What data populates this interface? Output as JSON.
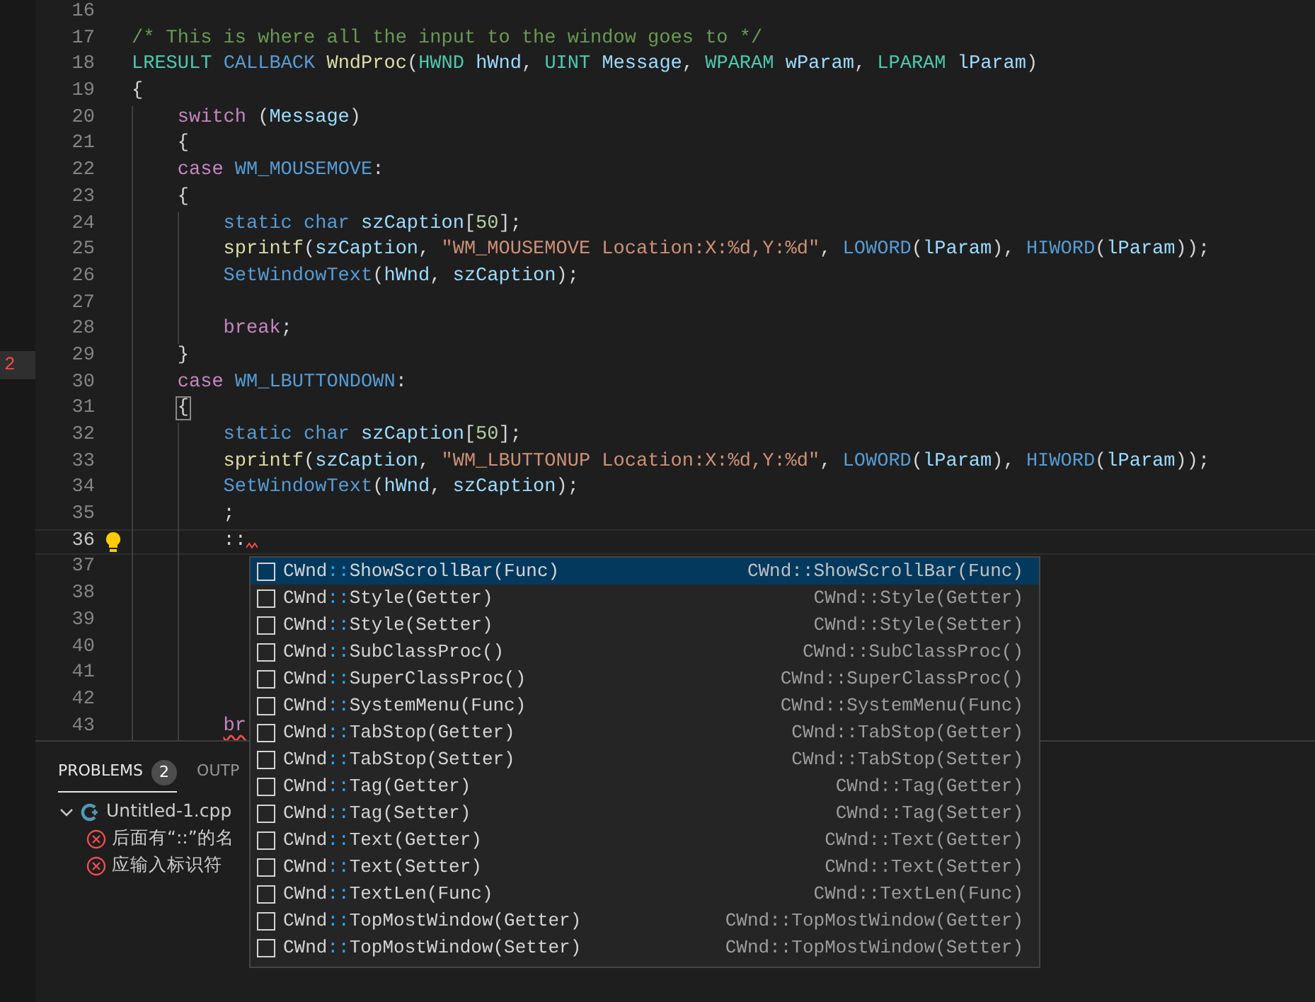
{
  "side_strip": {
    "marker": "2"
  },
  "editor": {
    "lines": [
      {
        "number": "16"
      },
      {
        "number": "17",
        "tokens": [
          {
            "kind": "comment",
            "text": "/* This is where all the input to the window goes to */"
          }
        ]
      },
      {
        "number": "18",
        "tokens": [
          {
            "kind": "type",
            "text": "LRESULT "
          },
          {
            "kind": "macro",
            "text": "CALLBACK "
          },
          {
            "kind": "func",
            "text": "WndProc"
          },
          {
            "kind": "plain",
            "text": "("
          },
          {
            "kind": "type",
            "text": "HWND "
          },
          {
            "kind": "var",
            "text": "hWnd"
          },
          {
            "kind": "plain",
            "text": ", "
          },
          {
            "kind": "type",
            "text": "UINT "
          },
          {
            "kind": "var",
            "text": "Message"
          },
          {
            "kind": "plain",
            "text": ", "
          },
          {
            "kind": "type",
            "text": "WPARAM "
          },
          {
            "kind": "var",
            "text": "wParam"
          },
          {
            "kind": "plain",
            "text": ", "
          },
          {
            "kind": "type",
            "text": "LPARAM "
          },
          {
            "kind": "var",
            "text": "lParam"
          },
          {
            "kind": "plain",
            "text": ")"
          }
        ]
      },
      {
        "number": "19",
        "tokens": [
          {
            "kind": "plain",
            "text": "{"
          }
        ]
      },
      {
        "number": "20",
        "tokens": [
          {
            "kind": "control",
            "text": "    switch"
          },
          {
            "kind": "plain",
            "text": " ("
          },
          {
            "kind": "var",
            "text": "Message"
          },
          {
            "kind": "plain",
            "text": ")"
          }
        ]
      },
      {
        "number": "21",
        "tokens": [
          {
            "kind": "plain",
            "text": "    {"
          }
        ]
      },
      {
        "number": "22",
        "tokens": [
          {
            "kind": "control",
            "text": "    case "
          },
          {
            "kind": "macro",
            "text": "WM_MOUSEMOVE"
          },
          {
            "kind": "plain",
            "text": ":"
          }
        ]
      },
      {
        "number": "23",
        "tokens": [
          {
            "kind": "plain",
            "text": "    {"
          }
        ]
      },
      {
        "number": "24",
        "tokens": [
          {
            "kind": "macro",
            "text": "        static char "
          },
          {
            "kind": "var",
            "text": "szCaption"
          },
          {
            "kind": "plain",
            "text": "["
          },
          {
            "kind": "number",
            "text": "50"
          },
          {
            "kind": "plain",
            "text": "];"
          }
        ]
      },
      {
        "number": "25",
        "tokens": [
          {
            "kind": "func",
            "text": "        sprintf"
          },
          {
            "kind": "plain",
            "text": "("
          },
          {
            "kind": "var",
            "text": "szCaption"
          },
          {
            "kind": "plain",
            "text": ", "
          },
          {
            "kind": "string",
            "text": "\"WM_MOUSEMOVE Location:X:%d,Y:%d\""
          },
          {
            "kind": "plain",
            "text": ", "
          },
          {
            "kind": "macro",
            "text": "LOWORD"
          },
          {
            "kind": "plain",
            "text": "("
          },
          {
            "kind": "var",
            "text": "lParam"
          },
          {
            "kind": "plain",
            "text": "), "
          },
          {
            "kind": "macro",
            "text": "HIWORD"
          },
          {
            "kind": "plain",
            "text": "("
          },
          {
            "kind": "var",
            "text": "lParam"
          },
          {
            "kind": "plain",
            "text": "));"
          }
        ]
      },
      {
        "number": "26",
        "tokens": [
          {
            "kind": "macro",
            "text": "        SetWindowText"
          },
          {
            "kind": "plain",
            "text": "("
          },
          {
            "kind": "var",
            "text": "hWnd"
          },
          {
            "kind": "plain",
            "text": ", "
          },
          {
            "kind": "var",
            "text": "szCaption"
          },
          {
            "kind": "plain",
            "text": ");"
          }
        ]
      },
      {
        "number": "27"
      },
      {
        "number": "28",
        "tokens": [
          {
            "kind": "control",
            "text": "        break"
          },
          {
            "kind": "plain",
            "text": ";"
          }
        ]
      },
      {
        "number": "29",
        "tokens": [
          {
            "kind": "plain",
            "text": "    }"
          }
        ]
      },
      {
        "number": "30",
        "tokens": [
          {
            "kind": "control",
            "text": "    case "
          },
          {
            "kind": "macro",
            "text": "WM_LBUTTONDOWN"
          },
          {
            "kind": "plain",
            "text": ":"
          }
        ]
      },
      {
        "number": "31",
        "tokens": [
          {
            "kind": "plain",
            "text": "    {",
            "bracket_match": true
          }
        ]
      },
      {
        "number": "32",
        "tokens": [
          {
            "kind": "macro",
            "text": "        static char "
          },
          {
            "kind": "var",
            "text": "szCaption"
          },
          {
            "kind": "plain",
            "text": "["
          },
          {
            "kind": "number",
            "text": "50"
          },
          {
            "kind": "plain",
            "text": "];"
          }
        ]
      },
      {
        "number": "33",
        "tokens": [
          {
            "kind": "func",
            "text": "        sprintf"
          },
          {
            "kind": "plain",
            "text": "("
          },
          {
            "kind": "var",
            "text": "szCaption"
          },
          {
            "kind": "plain",
            "text": ", "
          },
          {
            "kind": "string",
            "text": "\"WM_LBUTTONUP Location:X:%d,Y:%d\""
          },
          {
            "kind": "plain",
            "text": ", "
          },
          {
            "kind": "macro",
            "text": "LOWORD"
          },
          {
            "kind": "plain",
            "text": "("
          },
          {
            "kind": "var",
            "text": "lParam"
          },
          {
            "kind": "plain",
            "text": "), "
          },
          {
            "kind": "macro",
            "text": "HIWORD"
          },
          {
            "kind": "plain",
            "text": "("
          },
          {
            "kind": "var",
            "text": "lParam"
          },
          {
            "kind": "plain",
            "text": "));"
          }
        ]
      },
      {
        "number": "34",
        "tokens": [
          {
            "kind": "macro",
            "text": "        SetWindowText"
          },
          {
            "kind": "plain",
            "text": "("
          },
          {
            "kind": "var",
            "text": "hWnd"
          },
          {
            "kind": "plain",
            "text": ", "
          },
          {
            "kind": "var",
            "text": "szCaption"
          },
          {
            "kind": "plain",
            "text": ");"
          }
        ]
      },
      {
        "number": "35",
        "tokens": [
          {
            "kind": "plain",
            "text": "        ;"
          }
        ]
      },
      {
        "number": "36",
        "current": true,
        "lightbulb": true,
        "error_after": true,
        "tokens": [
          {
            "kind": "plain",
            "text": "        ::"
          }
        ]
      },
      {
        "number": "37"
      },
      {
        "number": "38"
      },
      {
        "number": "39"
      },
      {
        "number": "40"
      },
      {
        "number": "41"
      },
      {
        "number": "42"
      },
      {
        "number": "43",
        "tokens": [
          {
            "kind": "control",
            "text": "        br",
            "error": true
          }
        ]
      }
    ]
  },
  "suggestions": [
    {
      "selected": true,
      "label_parts": [
        {
          "text": "CWnd",
          "match": false
        },
        {
          "text": "::",
          "match": true
        },
        {
          "text": "ShowScrollBar(Func)",
          "match": false
        }
      ],
      "detail": "CWnd::ShowScrollBar(Func)"
    },
    {
      "selected": false,
      "label_parts": [
        {
          "text": "CWnd",
          "match": false
        },
        {
          "text": "::",
          "match": true
        },
        {
          "text": "Style(Getter)",
          "match": false
        }
      ],
      "detail": "CWnd::Style(Getter)"
    },
    {
      "selected": false,
      "label_parts": [
        {
          "text": "CWnd",
          "match": false
        },
        {
          "text": "::",
          "match": true
        },
        {
          "text": "Style(Setter)",
          "match": false
        }
      ],
      "detail": "CWnd::Style(Setter)"
    },
    {
      "selected": false,
      "label_parts": [
        {
          "text": "CWnd",
          "match": false
        },
        {
          "text": "::",
          "match": true
        },
        {
          "text": "SubClassProc()",
          "match": false
        }
      ],
      "detail": "CWnd::SubClassProc()"
    },
    {
      "selected": false,
      "label_parts": [
        {
          "text": "CWnd",
          "match": false
        },
        {
          "text": "::",
          "match": true
        },
        {
          "text": "SuperClassProc()",
          "match": false
        }
      ],
      "detail": "CWnd::SuperClassProc()"
    },
    {
      "selected": false,
      "label_parts": [
        {
          "text": "CWnd",
          "match": false
        },
        {
          "text": "::",
          "match": true
        },
        {
          "text": "SystemMenu(Func)",
          "match": false
        }
      ],
      "detail": "CWnd::SystemMenu(Func)"
    },
    {
      "selected": false,
      "label_parts": [
        {
          "text": "CWnd",
          "match": false
        },
        {
          "text": "::",
          "match": true
        },
        {
          "text": "TabStop(Getter)",
          "match": false
        }
      ],
      "detail": "CWnd::TabStop(Getter)"
    },
    {
      "selected": false,
      "label_parts": [
        {
          "text": "CWnd",
          "match": false
        },
        {
          "text": "::",
          "match": true
        },
        {
          "text": "TabStop(Setter)",
          "match": false
        }
      ],
      "detail": "CWnd::TabStop(Setter)"
    },
    {
      "selected": false,
      "label_parts": [
        {
          "text": "CWnd",
          "match": false
        },
        {
          "text": "::",
          "match": true
        },
        {
          "text": "Tag(Getter)",
          "match": false
        }
      ],
      "detail": "CWnd::Tag(Getter)"
    },
    {
      "selected": false,
      "label_parts": [
        {
          "text": "CWnd",
          "match": false
        },
        {
          "text": "::",
          "match": true
        },
        {
          "text": "Tag(Setter)",
          "match": false
        }
      ],
      "detail": "CWnd::Tag(Setter)"
    },
    {
      "selected": false,
      "label_parts": [
        {
          "text": "CWnd",
          "match": false
        },
        {
          "text": "::",
          "match": true
        },
        {
          "text": "Text(Getter)",
          "match": false
        }
      ],
      "detail": "CWnd::Text(Getter)"
    },
    {
      "selected": false,
      "label_parts": [
        {
          "text": "CWnd",
          "match": false
        },
        {
          "text": "::",
          "match": true
        },
        {
          "text": "Text(Setter)",
          "match": false
        }
      ],
      "detail": "CWnd::Text(Setter)"
    },
    {
      "selected": false,
      "label_parts": [
        {
          "text": "CWnd",
          "match": false
        },
        {
          "text": "::",
          "match": true
        },
        {
          "text": "TextLen(Func)",
          "match": false
        }
      ],
      "detail": "CWnd::TextLen(Func)"
    },
    {
      "selected": false,
      "label_parts": [
        {
          "text": "CWnd",
          "match": false
        },
        {
          "text": "::",
          "match": true
        },
        {
          "text": "TopMostWindow(Getter)",
          "match": false
        }
      ],
      "detail": "CWnd::TopMostWindow(Getter)"
    },
    {
      "selected": false,
      "label_parts": [
        {
          "text": "CWnd",
          "match": false
        },
        {
          "text": "::",
          "match": true
        },
        {
          "text": "TopMostWindow(Setter)",
          "match": false
        }
      ],
      "detail": "CWnd::TopMostWindow(Setter)"
    }
  ],
  "panel": {
    "tabs": [
      {
        "label": "PROBLEMS",
        "badge": "2",
        "selected": true
      },
      {
        "label": "OUTP",
        "selected": false
      }
    ],
    "problems": {
      "file": "Untitled-1.cpp",
      "expanded": true,
      "items": [
        {
          "message": "后面有“::”的名"
        },
        {
          "message": "应输入标识符"
        }
      ]
    }
  }
}
